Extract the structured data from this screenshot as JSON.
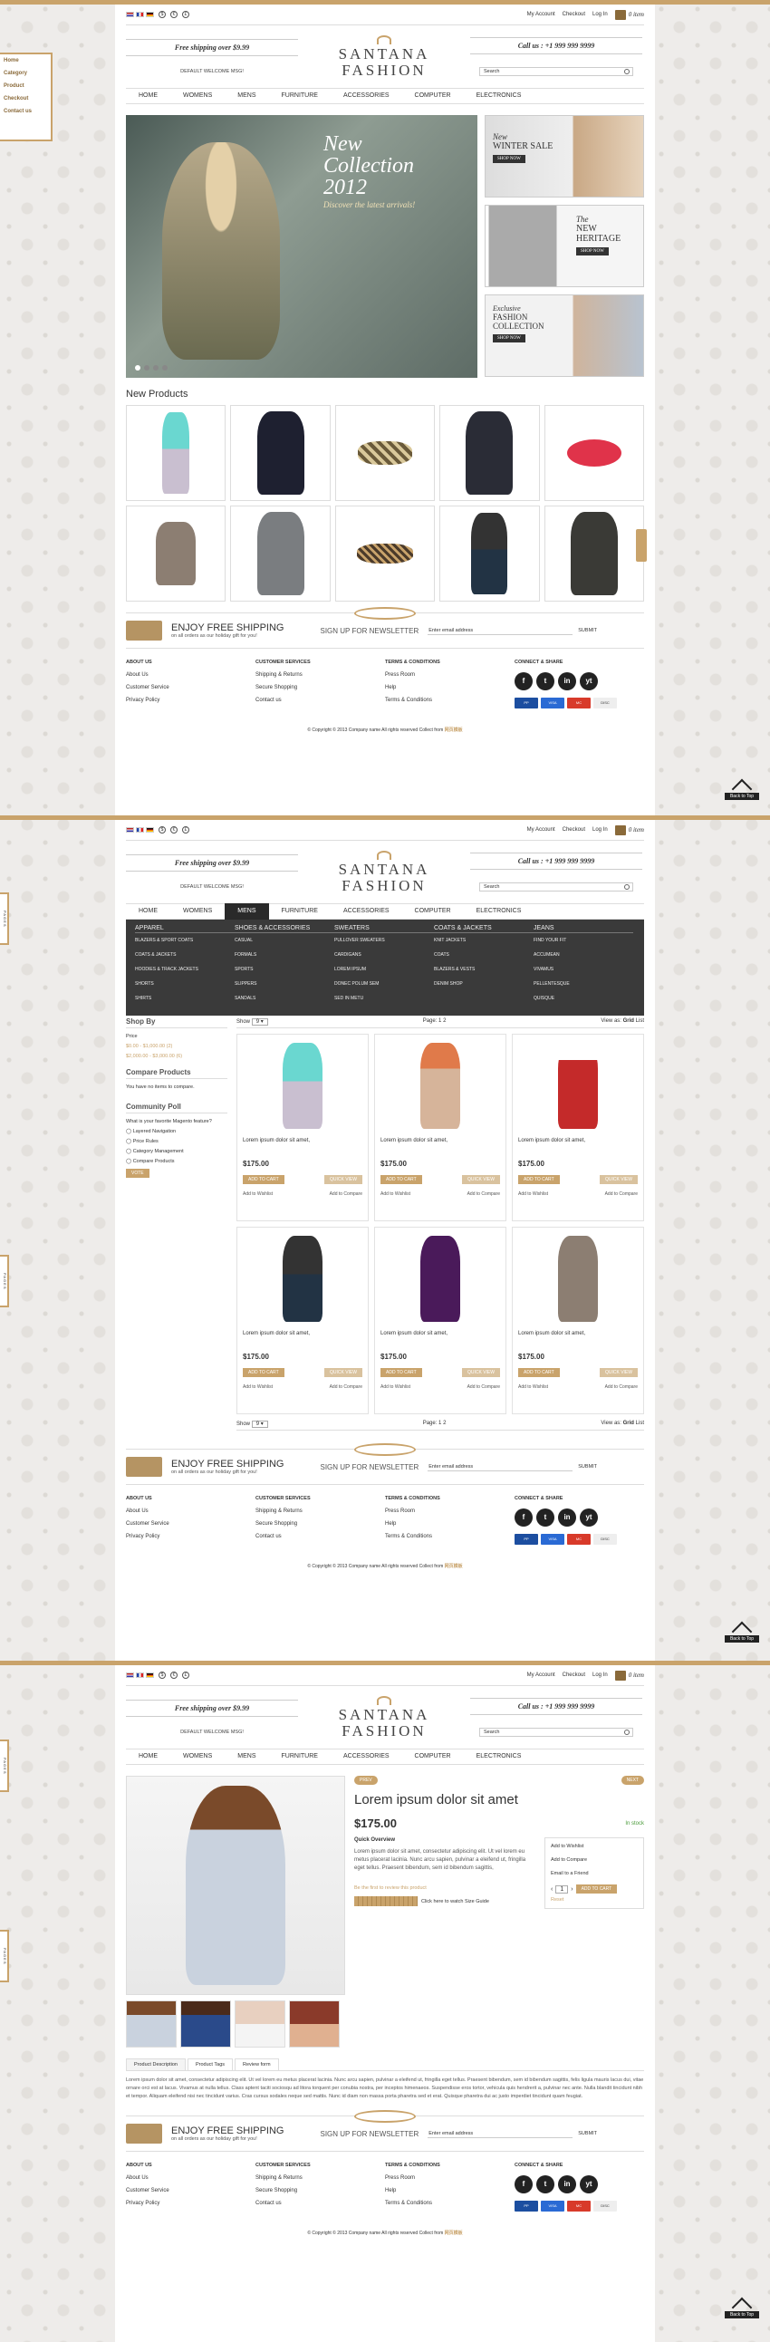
{
  "topbar": {
    "links": [
      "My Account",
      "Checkout",
      "Log In"
    ],
    "cart": "0 item"
  },
  "header": {
    "shipping": "Free shipping over $9.99",
    "welcome": "DEFAULT WELCOME MSG!",
    "logo_line1": "SANTANA",
    "logo_line2": "FASHION",
    "call": "Call us : +1 999 999 9999",
    "search_placeholder": "Search"
  },
  "nav": [
    "HOME",
    "WOMENS",
    "MENS",
    "FURNITURE",
    "ACCESSORIES",
    "COMPUTER",
    "ELECTRONICS"
  ],
  "sidetab": {
    "items": [
      "Home",
      "Category",
      "Product",
      "Checkout",
      "Contact us"
    ],
    "label": "PAGES"
  },
  "hero": {
    "title_line1": "New",
    "title_line2": "Collection",
    "title_line3": "2012",
    "subtitle": "Discover the latest arrivals!"
  },
  "banners": [
    {
      "line1": "New",
      "line2": "WINTER SALE",
      "btn": "SHOP NOW"
    },
    {
      "line1": "The",
      "line2": "NEW",
      "line3": "HERITAGE",
      "btn": "SHOP NOW"
    },
    {
      "line1": "Exclusive",
      "line2": "FASHION",
      "line3": "COLLECTION",
      "btn": "SHOP NOW"
    }
  ],
  "new_products_title": "New Products",
  "shipping_bar": {
    "title": "ENJOY FREE SHIPPING",
    "sub": "on all orders as our holiday gift for you!",
    "newsletter": "SIGN UP FOR NEWSLETTER",
    "email_placeholder": "Enter email address",
    "submit": "SUBMIT"
  },
  "footer": {
    "cols": [
      {
        "title": "ABOUT US",
        "items": [
          "About Us",
          "Customer Service",
          "Privacy Policy"
        ]
      },
      {
        "title": "CUSTOMER SERVICES",
        "items": [
          "Shipping & Returns",
          "Secure Shopping",
          "Contact us"
        ]
      },
      {
        "title": "TERMS & CONDITIONS",
        "items": [
          "Press Room",
          "Help",
          "Terms & Conditions"
        ]
      }
    ],
    "social_title": "CONNECT & SHARE",
    "social": [
      "f",
      "t",
      "in",
      "yt"
    ],
    "copyright": "© Copyright © 2013 Company name All rights reserved",
    "collect": "Collect from",
    "collect_link": "网页模板"
  },
  "back_to_top": "Back to Top",
  "mega_menu": [
    {
      "title": "APPAREL",
      "items": [
        "BLAZERS & SPORT COATS",
        "COATS & JACKETS",
        "HOODIES & TRACK JACKETS",
        "SHORTS",
        "SHIRTS"
      ]
    },
    {
      "title": "SHOES & ACCESSORIES",
      "items": [
        "CASUAL",
        "FORMALS",
        "SPORTS",
        "SLIPPERS",
        "SANDALS"
      ]
    },
    {
      "title": "SWEATERS",
      "items": [
        "PULLOVER SWEATERS",
        "CARDIGANS",
        "LOREM IPSUM",
        "DONEC POLUM SEM",
        "SED IN METU"
      ]
    },
    {
      "title": "COATS & JACKETS",
      "items": [
        "KNIT JACKETS",
        "COATS",
        "BLAZERS & VESTS",
        "DENIM SHOP"
      ]
    },
    {
      "title": "JEANS",
      "items": [
        "FIND YOUR FIT",
        "ACCUMEAN",
        "VIVAMUS",
        "PELLENTESQUE",
        "QUISQUE"
      ]
    }
  ],
  "category": {
    "shop_by": "Shop By",
    "price_label": "Price",
    "price1": "$0.00 - $1,000.00 (2)",
    "price2": "$2,000.00 - $3,000.00 (6)",
    "compare_title": "Compare Products",
    "compare_text": "You have no items to compare.",
    "poll_title": "Community Poll",
    "poll_q": "What is your favorite Magento feature?",
    "poll_opts": [
      "Layered Navigation",
      "Price Rules",
      "Category Management",
      "Compare Products"
    ],
    "vote": "VOTE",
    "show": "Show",
    "page": "Page:",
    "view_as": "View as:",
    "grid": "Grid",
    "list": "List",
    "product_name": "Lorem ipsum dolor sit amet,",
    "price": "$175.00",
    "add_to_cart": "ADD TO CART",
    "quick_view": "QUICK VIEW",
    "wishlist": "Add to Wishlist",
    "compare": "Add to Compare"
  },
  "product": {
    "prev": "PREV",
    "next": "NEXT",
    "title": "Lorem ipsum dolor sit amet",
    "price": "$175.00",
    "stock": "In stock",
    "overview_title": "Quick Overview",
    "overview": "Lorem ipsum dolor sit amet, consectetur adipiscing elit. Ut vel lorem eu metus placerat lacinia. Nunc arcu sapien, pulvinar a eleifend ut, fringilla eget tellus. Praesent bibendum, sem id bibendum sagittis,",
    "review": "Be the first to review this product",
    "size_guide": "Click here to watch Size Guide",
    "wishlist": "Add to Wishlist",
    "compare": "Add to Compare",
    "email": "Email to a Friend",
    "qty": "1",
    "add_to_cart": "ADD TO CART",
    "reset": "Reset",
    "tabs": [
      "Product Description",
      "Product Tags",
      "Review form"
    ],
    "description": "Lorem ipsum dolor sit amet, consectetur adipiscing elit. Ut vel lorem eu metus placerat lacinia. Nunc arcu sapien, pulvinar a eleifend ut, fringilla eget tellus. Praesent bibendum, sem id bibendum sagittis, felis ligula mauris lacus dui, vitae ornare orci est at lacus. Vivamus at nulla tellus. Class aptent taciti sociosqu ad litora torquent per conubia nostra, per inceptos himenaeos. Suspendisse eros tortor, vehicula quis hendrerit a, pulvinar nec ante. Nulla blandit tincidunt nibh et tempor. Aliquam eleifend nisi nec tincidunt varius. Cras cursus sodales neque sed mattis. Nunc id diam non massa porta pharetra sed et erat. Quisque pharetra dui ac justo imperdiet tincidunt quam feugiat."
  }
}
